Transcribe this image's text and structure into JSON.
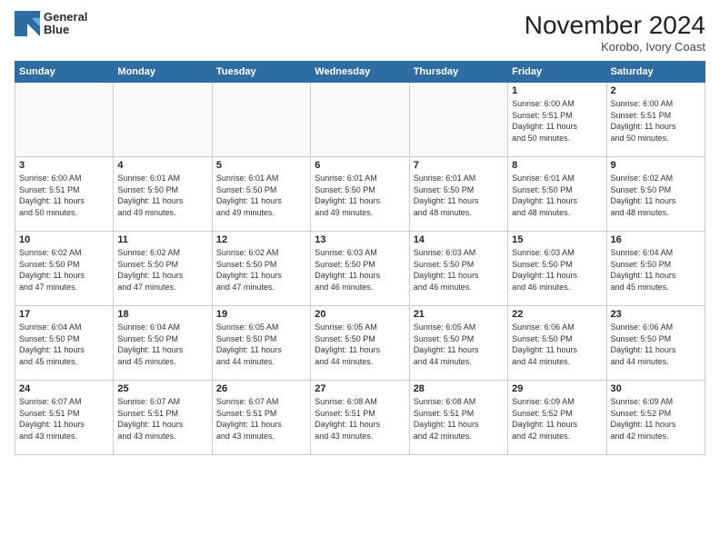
{
  "logo": {
    "line1": "General",
    "line2": "Blue"
  },
  "header": {
    "month": "November 2024",
    "location": "Korobo, Ivory Coast"
  },
  "weekdays": [
    "Sunday",
    "Monday",
    "Tuesday",
    "Wednesday",
    "Thursday",
    "Friday",
    "Saturday"
  ],
  "weeks": [
    [
      {
        "day": "",
        "info": ""
      },
      {
        "day": "",
        "info": ""
      },
      {
        "day": "",
        "info": ""
      },
      {
        "day": "",
        "info": ""
      },
      {
        "day": "",
        "info": ""
      },
      {
        "day": "1",
        "info": "Sunrise: 6:00 AM\nSunset: 5:51 PM\nDaylight: 11 hours\nand 50 minutes."
      },
      {
        "day": "2",
        "info": "Sunrise: 6:00 AM\nSunset: 5:51 PM\nDaylight: 11 hours\nand 50 minutes."
      }
    ],
    [
      {
        "day": "3",
        "info": "Sunrise: 6:00 AM\nSunset: 5:51 PM\nDaylight: 11 hours\nand 50 minutes."
      },
      {
        "day": "4",
        "info": "Sunrise: 6:01 AM\nSunset: 5:50 PM\nDaylight: 11 hours\nand 49 minutes."
      },
      {
        "day": "5",
        "info": "Sunrise: 6:01 AM\nSunset: 5:50 PM\nDaylight: 11 hours\nand 49 minutes."
      },
      {
        "day": "6",
        "info": "Sunrise: 6:01 AM\nSunset: 5:50 PM\nDaylight: 11 hours\nand 49 minutes."
      },
      {
        "day": "7",
        "info": "Sunrise: 6:01 AM\nSunset: 5:50 PM\nDaylight: 11 hours\nand 48 minutes."
      },
      {
        "day": "8",
        "info": "Sunrise: 6:01 AM\nSunset: 5:50 PM\nDaylight: 11 hours\nand 48 minutes."
      },
      {
        "day": "9",
        "info": "Sunrise: 6:02 AM\nSunset: 5:50 PM\nDaylight: 11 hours\nand 48 minutes."
      }
    ],
    [
      {
        "day": "10",
        "info": "Sunrise: 6:02 AM\nSunset: 5:50 PM\nDaylight: 11 hours\nand 47 minutes."
      },
      {
        "day": "11",
        "info": "Sunrise: 6:02 AM\nSunset: 5:50 PM\nDaylight: 11 hours\nand 47 minutes."
      },
      {
        "day": "12",
        "info": "Sunrise: 6:02 AM\nSunset: 5:50 PM\nDaylight: 11 hours\nand 47 minutes."
      },
      {
        "day": "13",
        "info": "Sunrise: 6:03 AM\nSunset: 5:50 PM\nDaylight: 11 hours\nand 46 minutes."
      },
      {
        "day": "14",
        "info": "Sunrise: 6:03 AM\nSunset: 5:50 PM\nDaylight: 11 hours\nand 46 minutes."
      },
      {
        "day": "15",
        "info": "Sunrise: 6:03 AM\nSunset: 5:50 PM\nDaylight: 11 hours\nand 46 minutes."
      },
      {
        "day": "16",
        "info": "Sunrise: 6:04 AM\nSunset: 5:50 PM\nDaylight: 11 hours\nand 45 minutes."
      }
    ],
    [
      {
        "day": "17",
        "info": "Sunrise: 6:04 AM\nSunset: 5:50 PM\nDaylight: 11 hours\nand 45 minutes."
      },
      {
        "day": "18",
        "info": "Sunrise: 6:04 AM\nSunset: 5:50 PM\nDaylight: 11 hours\nand 45 minutes."
      },
      {
        "day": "19",
        "info": "Sunrise: 6:05 AM\nSunset: 5:50 PM\nDaylight: 11 hours\nand 44 minutes."
      },
      {
        "day": "20",
        "info": "Sunrise: 6:05 AM\nSunset: 5:50 PM\nDaylight: 11 hours\nand 44 minutes."
      },
      {
        "day": "21",
        "info": "Sunrise: 6:05 AM\nSunset: 5:50 PM\nDaylight: 11 hours\nand 44 minutes."
      },
      {
        "day": "22",
        "info": "Sunrise: 6:06 AM\nSunset: 5:50 PM\nDaylight: 11 hours\nand 44 minutes."
      },
      {
        "day": "23",
        "info": "Sunrise: 6:06 AM\nSunset: 5:50 PM\nDaylight: 11 hours\nand 44 minutes."
      }
    ],
    [
      {
        "day": "24",
        "info": "Sunrise: 6:07 AM\nSunset: 5:51 PM\nDaylight: 11 hours\nand 43 minutes."
      },
      {
        "day": "25",
        "info": "Sunrise: 6:07 AM\nSunset: 5:51 PM\nDaylight: 11 hours\nand 43 minutes."
      },
      {
        "day": "26",
        "info": "Sunrise: 6:07 AM\nSunset: 5:51 PM\nDaylight: 11 hours\nand 43 minutes."
      },
      {
        "day": "27",
        "info": "Sunrise: 6:08 AM\nSunset: 5:51 PM\nDaylight: 11 hours\nand 43 minutes."
      },
      {
        "day": "28",
        "info": "Sunrise: 6:08 AM\nSunset: 5:51 PM\nDaylight: 11 hours\nand 42 minutes."
      },
      {
        "day": "29",
        "info": "Sunrise: 6:09 AM\nSunset: 5:52 PM\nDaylight: 11 hours\nand 42 minutes."
      },
      {
        "day": "30",
        "info": "Sunrise: 6:09 AM\nSunset: 5:52 PM\nDaylight: 11 hours\nand 42 minutes."
      }
    ]
  ]
}
